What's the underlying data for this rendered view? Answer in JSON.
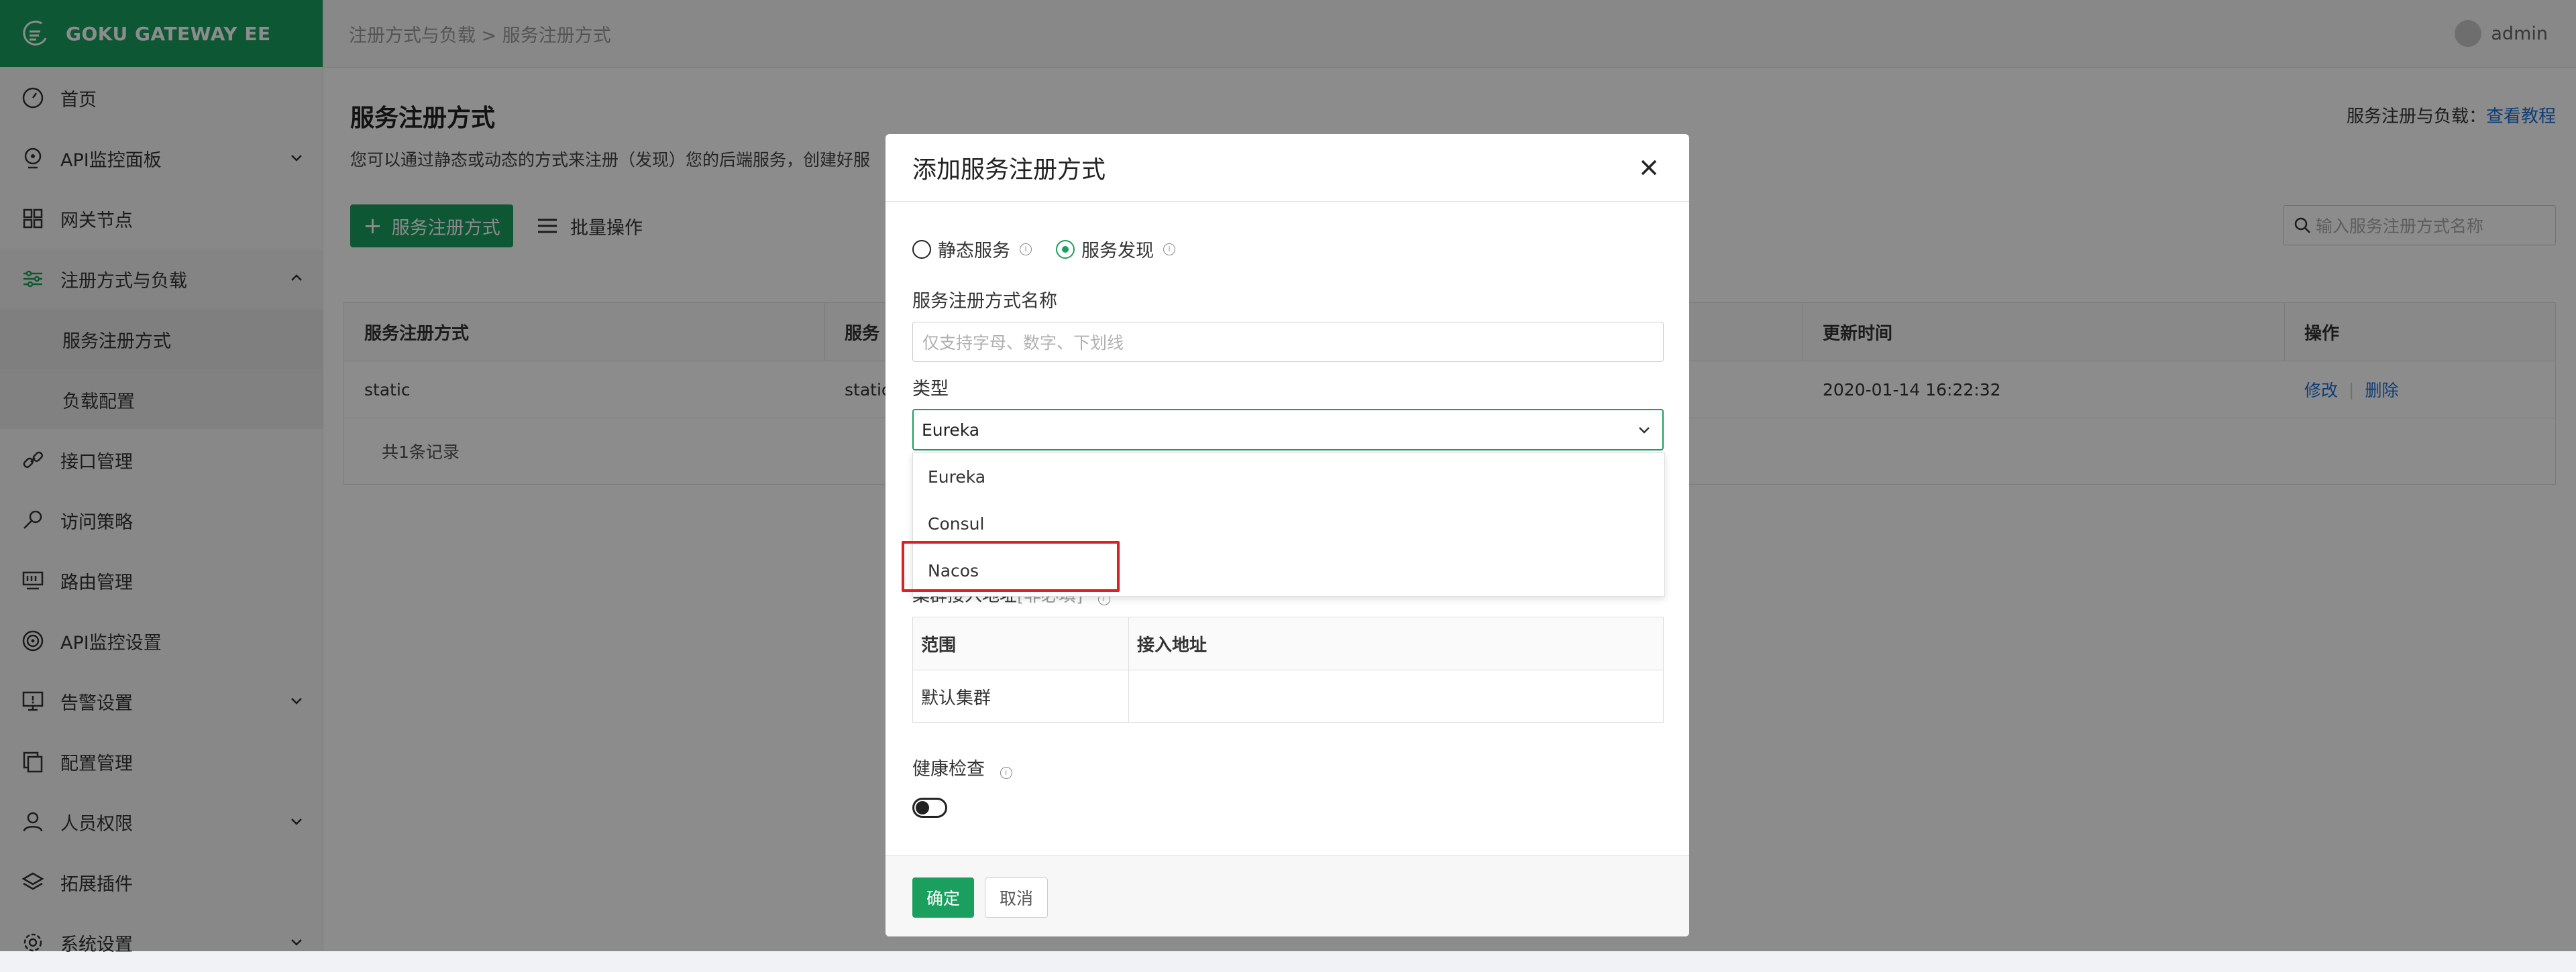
{
  "app": {
    "logo_text": "GOKU GATEWAY EE"
  },
  "colors": {
    "primary": "#1a9f5f",
    "link": "#1a6fd8",
    "highlight": "#e02020"
  },
  "sidebar": {
    "items": [
      {
        "label": "首页",
        "icon": "dashboard-icon"
      },
      {
        "label": "API监控面板",
        "icon": "monitor-panel-icon",
        "expandable": true
      },
      {
        "label": "网关节点",
        "icon": "grid-icon"
      },
      {
        "label": "注册方式与负载",
        "icon": "sliders-icon",
        "expanded": true
      },
      {
        "label": "服务注册方式",
        "sub": true,
        "active": true
      },
      {
        "label": "负载配置",
        "sub": true
      },
      {
        "label": "接口管理",
        "icon": "link-icon"
      },
      {
        "label": "访问策略",
        "icon": "key-icon"
      },
      {
        "label": "路由管理",
        "icon": "route-icon"
      },
      {
        "label": "API监控设置",
        "icon": "target-icon"
      },
      {
        "label": "告警设置",
        "icon": "alarm-icon",
        "expandable": true
      },
      {
        "label": "配置管理",
        "icon": "copy-icon"
      },
      {
        "label": "人员权限",
        "icon": "user-icon",
        "expandable": true
      },
      {
        "label": "拓展插件",
        "icon": "layers-icon"
      },
      {
        "label": "系统设置",
        "icon": "settings-icon",
        "expandable": true
      }
    ]
  },
  "topbar": {
    "breadcrumb": "注册方式与负载 > 服务注册方式",
    "user": "admin"
  },
  "main": {
    "title": "服务注册方式",
    "description": "您可以通过静态或动态的方式来注册（发现）您的后端服务，创建好服",
    "help_prefix": "服务注册与负载：",
    "help_link": "查看教程",
    "add_button": "服务注册方式",
    "batch_button": "批量操作",
    "search_placeholder": "输入服务注册方式名称",
    "table": {
      "headers": [
        "服务注册方式",
        "服务",
        "更新时间",
        "操作"
      ],
      "rows": [
        {
          "name": "static",
          "type": "static",
          "updated": "2020-01-14 16:22:32",
          "edit": "修改",
          "delete": "删除"
        }
      ],
      "footer": "共1条记录"
    }
  },
  "modal": {
    "title": "添加服务注册方式",
    "radio_static": "静态服务",
    "radio_discovery": "服务发现",
    "name_label": "服务注册方式名称",
    "name_placeholder": "仅支持字母、数字、下划线",
    "type_label": "类型",
    "type_value": "Eureka",
    "type_options": [
      "Eureka",
      "Consul",
      "Nacos"
    ],
    "highlighted_option": "Nacos",
    "cluster_label": "集群接入地址",
    "cluster_required": "[非必填]",
    "cluster_table": {
      "headers": [
        "范围",
        "接入地址"
      ],
      "rows": [
        [
          "默认集群",
          ""
        ]
      ]
    },
    "health_label": "健康检查",
    "health_enabled": false,
    "ok_button": "确定",
    "cancel_button": "取消"
  }
}
